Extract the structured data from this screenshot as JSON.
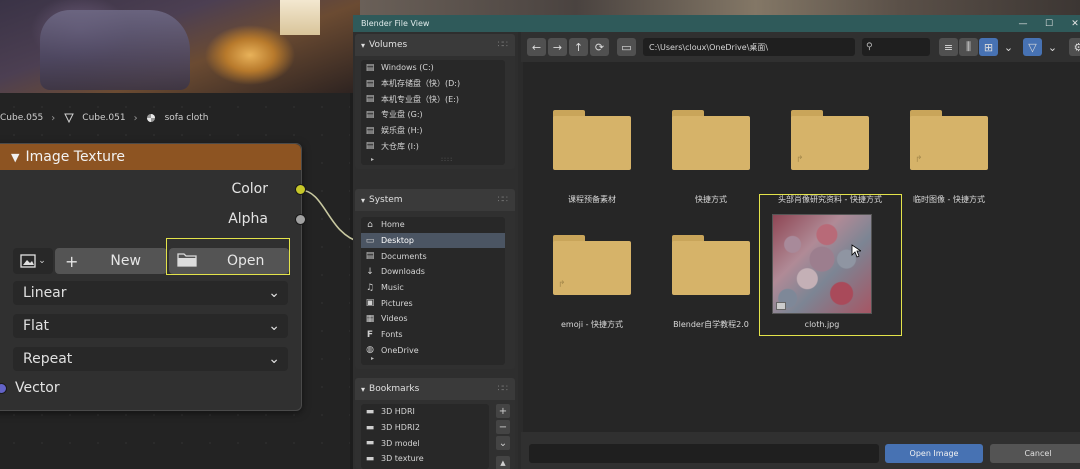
{
  "node_editor": {
    "breadcrumb": [
      "Cube.055",
      "Cube.051",
      "sofa cloth"
    ],
    "node": {
      "title": "Image Texture",
      "outputs": [
        "Color",
        "Alpha"
      ],
      "new_label": "New",
      "open_label": "Open",
      "interpolation": "Linear",
      "projection": "Flat",
      "extension": "Repeat",
      "input": "Vector"
    }
  },
  "file_browser": {
    "window_title": "Blender File View",
    "sidebar": {
      "volumes": {
        "title": "Volumes",
        "items": [
          "Windows (C:)",
          "本机存储盘（快）(D:)",
          "本机专业盘（快）(E:)",
          "专业盘 (G:)",
          "娱乐盘 (H:)",
          "大仓库 (I:)"
        ]
      },
      "system": {
        "title": "System",
        "items": [
          "Home",
          "Desktop",
          "Documents",
          "Downloads",
          "Music",
          "Pictures",
          "Videos",
          "Fonts",
          "OneDrive"
        ],
        "selected": "Desktop"
      },
      "bookmarks": {
        "title": "Bookmarks",
        "items": [
          "3D HDRI",
          "3D HDRI2",
          "3D model",
          "3D texture"
        ]
      }
    },
    "path": "C:\\Users\\cloux\\OneDrive\\桌面\\",
    "files": [
      {
        "name": "课程预备素材",
        "kind": "folder"
      },
      {
        "name": "快捷方式",
        "kind": "folder"
      },
      {
        "name": "头部肖像研究资料 - 快捷方式",
        "kind": "folder-link"
      },
      {
        "name": "临时图像 - 快捷方式",
        "kind": "folder-link"
      },
      {
        "name": "emoji - 快捷方式",
        "kind": "folder-link"
      },
      {
        "name": "Blender自学教程2.0",
        "kind": "folder"
      },
      {
        "name": "cloth.jpg",
        "kind": "image"
      }
    ],
    "open_button": "Open Image",
    "cancel_button": "Cancel"
  }
}
